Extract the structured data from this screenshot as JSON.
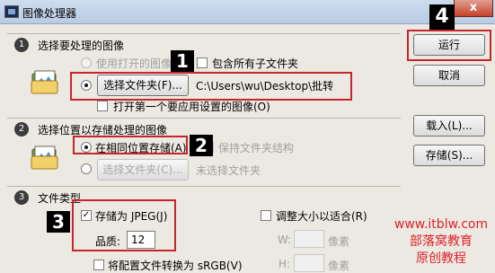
{
  "window": {
    "title": "图像处理器",
    "close_glyph": "x"
  },
  "section1": {
    "number": "1",
    "title": "选择要处理的图像",
    "use_open_images": "使用打开的图像",
    "include_subfolders": "包含所有子文件夹",
    "select_folder_button": "选择文件夹(F)...",
    "folder_path": "C:\\Users\\wu\\Desktop\\批转",
    "open_first_image": "打开第一个要应用设置的图像(O)"
  },
  "section2": {
    "number": "2",
    "title": "选择位置以存储处理的图像",
    "save_same_location": "在相同位置存储(A)",
    "keep_folder_structure": "保持文件夹结构",
    "select_folder_button": "选择文件夹(C)...",
    "no_folder_selected": "未选择文件夹"
  },
  "section3": {
    "number": "3",
    "title": "文件类型",
    "save_as_jpeg": "存储为 JPEG(J)",
    "quality_label": "品质:",
    "quality_value": "12",
    "resize_to_fit": "调整大小以适合(R)",
    "width_label": "W:",
    "height_label": "H:",
    "pixels_unit": "像素",
    "convert_srgb": "将配置文件转换为 sRGB(V)"
  },
  "buttons": {
    "run": "运行",
    "cancel": "取消",
    "load": "载入(L)...",
    "save": "存储(S)..."
  },
  "badges": {
    "b1": "1",
    "b2": "2",
    "b3": "3",
    "b4": "4"
  },
  "watermark": {
    "url": "www.itblw.com",
    "line1": "部落窝教育",
    "line2": "原创教程"
  },
  "colors": {
    "annotation_red": "#c8242b",
    "watermark_red": "#e0202a"
  }
}
